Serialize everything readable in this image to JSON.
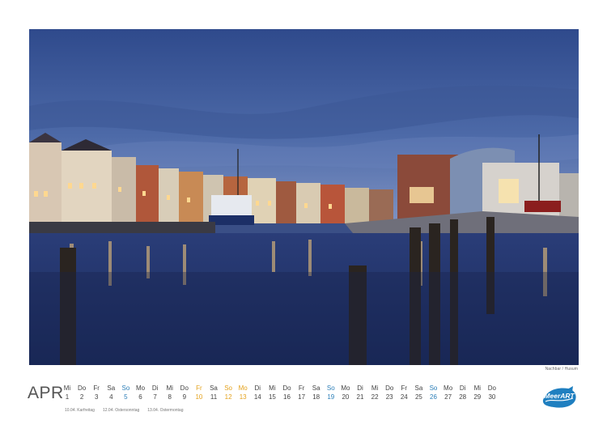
{
  "month": "APR",
  "caption": "Nachbar / Husum",
  "days": [
    {
      "wd": "Mi",
      "n": "1",
      "t": "n"
    },
    {
      "wd": "Do",
      "n": "2",
      "t": "n"
    },
    {
      "wd": "Fr",
      "n": "3",
      "t": "n"
    },
    {
      "wd": "Sa",
      "n": "4",
      "t": "n"
    },
    {
      "wd": "So",
      "n": "5",
      "t": "s"
    },
    {
      "wd": "Mo",
      "n": "6",
      "t": "n"
    },
    {
      "wd": "Di",
      "n": "7",
      "t": "n"
    },
    {
      "wd": "Mi",
      "n": "8",
      "t": "n"
    },
    {
      "wd": "Do",
      "n": "9",
      "t": "n"
    },
    {
      "wd": "Fr",
      "n": "10",
      "t": "h"
    },
    {
      "wd": "Sa",
      "n": "11",
      "t": "n"
    },
    {
      "wd": "So",
      "n": "12",
      "t": "h"
    },
    {
      "wd": "Mo",
      "n": "13",
      "t": "h"
    },
    {
      "wd": "Di",
      "n": "14",
      "t": "n"
    },
    {
      "wd": "Mi",
      "n": "15",
      "t": "n"
    },
    {
      "wd": "Do",
      "n": "16",
      "t": "n"
    },
    {
      "wd": "Fr",
      "n": "17",
      "t": "n"
    },
    {
      "wd": "Sa",
      "n": "18",
      "t": "n"
    },
    {
      "wd": "So",
      "n": "19",
      "t": "s"
    },
    {
      "wd": "Mo",
      "n": "20",
      "t": "n"
    },
    {
      "wd": "Di",
      "n": "21",
      "t": "n"
    },
    {
      "wd": "Mi",
      "n": "22",
      "t": "n"
    },
    {
      "wd": "Do",
      "n": "23",
      "t": "n"
    },
    {
      "wd": "Fr",
      "n": "24",
      "t": "n"
    },
    {
      "wd": "Sa",
      "n": "25",
      "t": "n"
    },
    {
      "wd": "So",
      "n": "26",
      "t": "s"
    },
    {
      "wd": "Mo",
      "n": "27",
      "t": "n"
    },
    {
      "wd": "Di",
      "n": "28",
      "t": "n"
    },
    {
      "wd": "Mi",
      "n": "29",
      "t": "n"
    },
    {
      "wd": "Do",
      "n": "30",
      "t": "n"
    }
  ],
  "holidays": [
    "10.04. Karfreitag",
    "12.04. Ostersonntag",
    "13.04. Ostermontag"
  ],
  "logo_text": "MeerART",
  "colors": {
    "sunday": "#2d7fb8",
    "holiday": "#e4a21d",
    "logo": "#1f7fc0"
  }
}
